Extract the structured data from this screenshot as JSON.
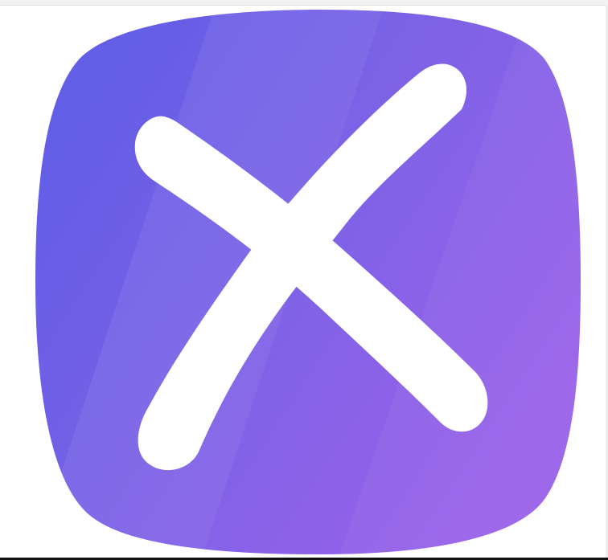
{
  "icon": {
    "name": "close-x-icon",
    "gradient": {
      "start": "#5e5fe8",
      "mid": "#7a62e6",
      "end": "#9a62ea"
    },
    "mark_color": "#ffffff"
  }
}
